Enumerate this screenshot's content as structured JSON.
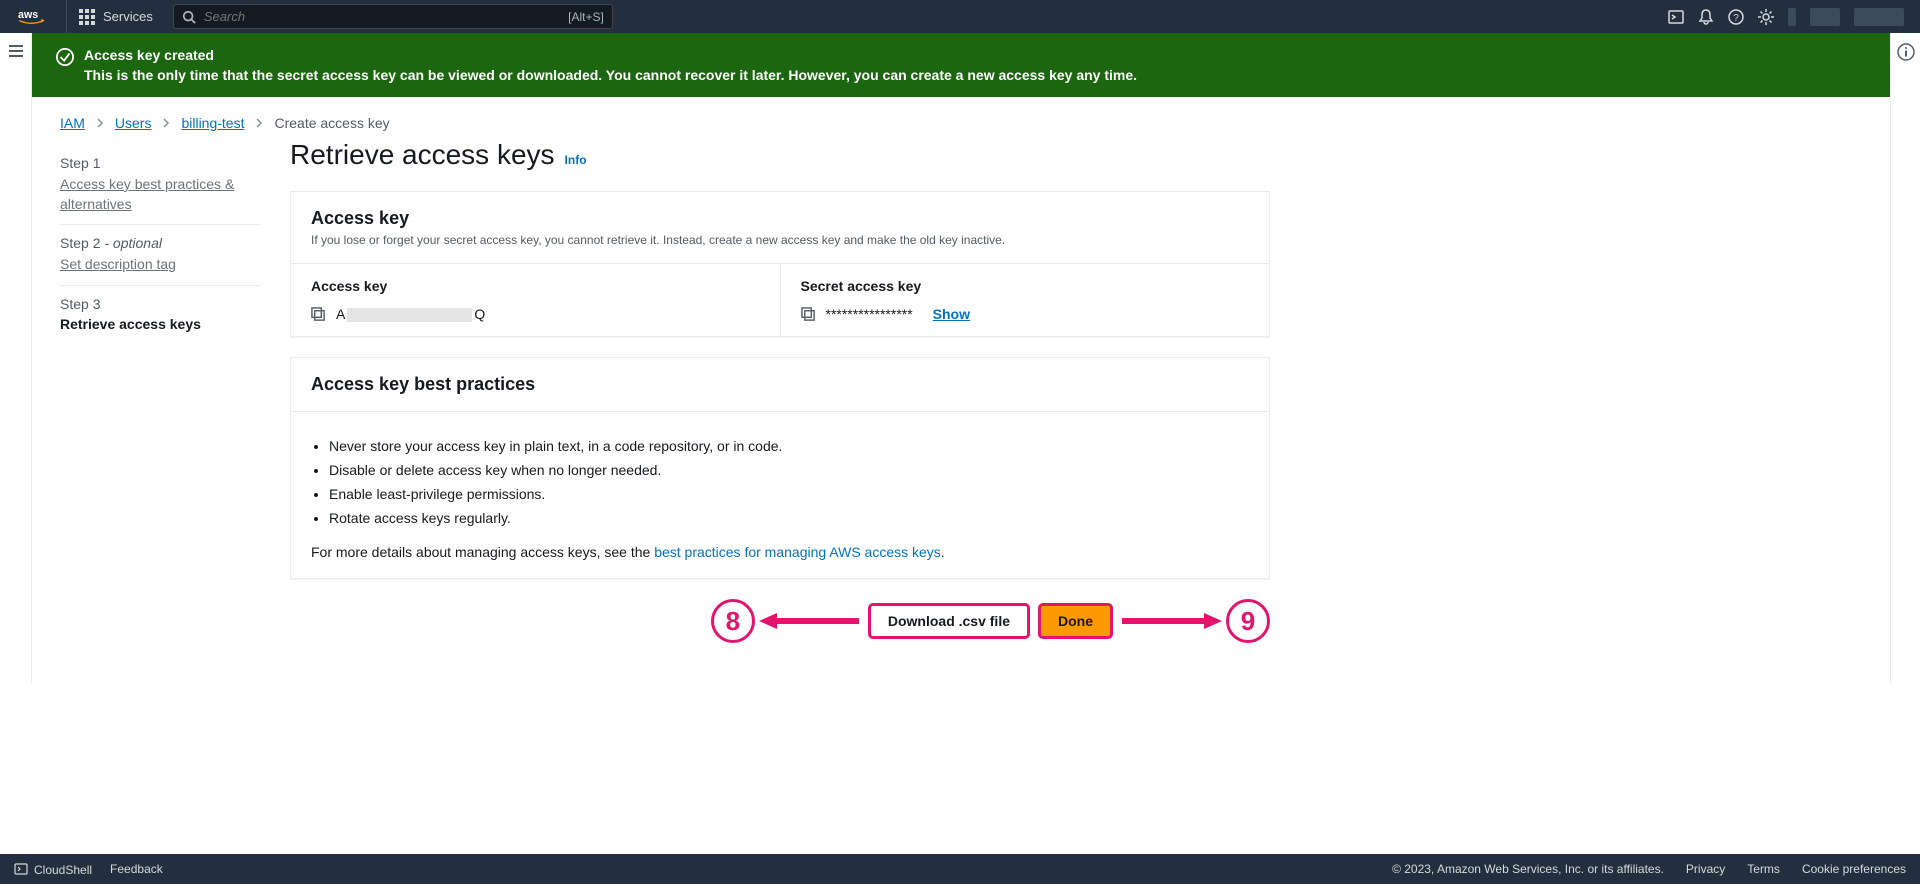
{
  "topnav": {
    "services": "Services",
    "search_placeholder": "Search",
    "search_shortcut": "[Alt+S]"
  },
  "flash": {
    "title": "Access key created",
    "message": "This is the only time that the secret access key can be viewed or downloaded. You cannot recover it later. However, you can create a new access key any time."
  },
  "breadcrumb": {
    "iam": "IAM",
    "users": "Users",
    "user": "billing-test",
    "current": "Create access key"
  },
  "wizard": {
    "step1_num": "Step 1",
    "step1_title": "Access key best practices & alternatives",
    "step2_num": "Step 2",
    "step2_optional": " - optional",
    "step2_title": "Set description tag",
    "step3_num": "Step 3",
    "step3_title": "Retrieve access keys"
  },
  "page": {
    "title": "Retrieve access keys",
    "info": "Info"
  },
  "accessKeyCard": {
    "title": "Access key",
    "desc": "If you lose or forget your secret access key, you cannot retrieve it. Instead, create a new access key and make the old key inactive.",
    "col1Label": "Access key",
    "col2Label": "Secret access key",
    "keyPrefix": "A",
    "keySuffix": "Q",
    "secretMask": "****************",
    "show": "Show"
  },
  "bpCard": {
    "title": "Access key best practices",
    "items": [
      "Never store your access key in plain text, in a code repository, or in code.",
      "Disable or delete access key when no longer needed.",
      "Enable least-privilege permissions.",
      "Rotate access keys regularly."
    ],
    "footPre": "For more details about managing access keys, see the ",
    "footLink": "best practices for managing AWS access keys",
    "footPost": "."
  },
  "actions": {
    "download": "Download .csv file",
    "done": "Done"
  },
  "annotations": {
    "left_num": "8",
    "right_num": "9"
  },
  "footer": {
    "cloudshell": "CloudShell",
    "feedback": "Feedback",
    "copyright": "© 2023, Amazon Web Services, Inc. or its affiliates.",
    "privacy": "Privacy",
    "terms": "Terms",
    "cookies": "Cookie preferences"
  }
}
